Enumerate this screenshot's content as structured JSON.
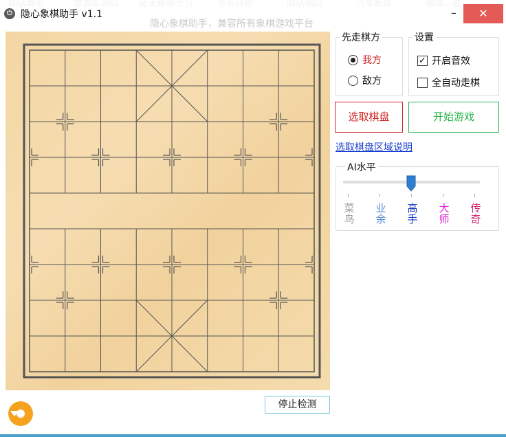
{
  "web_nav": [
    "网站首页",
    "易语言源码",
    "技术教程学习",
    "羊毛线报",
    "网站源码",
    "自学教程",
    "值得一看"
  ],
  "window": {
    "title": "隐心象棋助手 v1.1",
    "icon": "power-icon",
    "minimize_label": "–",
    "close_label": "✕",
    "close_color": "#e35a57"
  },
  "watermark": "隐心象棋助手，兼容所有象棋游戏平台",
  "board": {
    "colors": {
      "wood": "#f3d6a3",
      "line": "#555555"
    },
    "files": 9,
    "ranks": 10
  },
  "first_move_group": {
    "title": "先走棋方",
    "options": [
      {
        "label": "我方",
        "selected": true,
        "color": "#cc1f1f"
      },
      {
        "label": "敌方",
        "selected": false,
        "color": "#111111"
      }
    ]
  },
  "settings_group": {
    "title": "设置",
    "options": [
      {
        "label": "开启音效",
        "checked": true
      },
      {
        "label": "全自动走棋",
        "checked": false
      }
    ]
  },
  "buttons": {
    "select_board": {
      "label": "选取棋盘",
      "color": "#d12424"
    },
    "start_game": {
      "label": "开始游戏",
      "color": "#25b44a"
    },
    "stop_detect": {
      "label": "停止检测"
    }
  },
  "help_link": "选取棋盘区域说明",
  "ai_group": {
    "title": "AI水平",
    "levels": [
      {
        "label": "菜鸟",
        "color": "#9a9a9a"
      },
      {
        "label": "业余",
        "color": "#5b8ed6"
      },
      {
        "label": "高手",
        "color": "#1a3cbf"
      },
      {
        "label": "大师",
        "color": "#e024e0"
      },
      {
        "label": "传奇",
        "color": "#d3246a"
      }
    ],
    "selected_index": 2,
    "accent": "#2f7fd1"
  },
  "icons": {
    "refresh": "refresh-icon",
    "slider_thumb": "slider-thumb-icon"
  }
}
